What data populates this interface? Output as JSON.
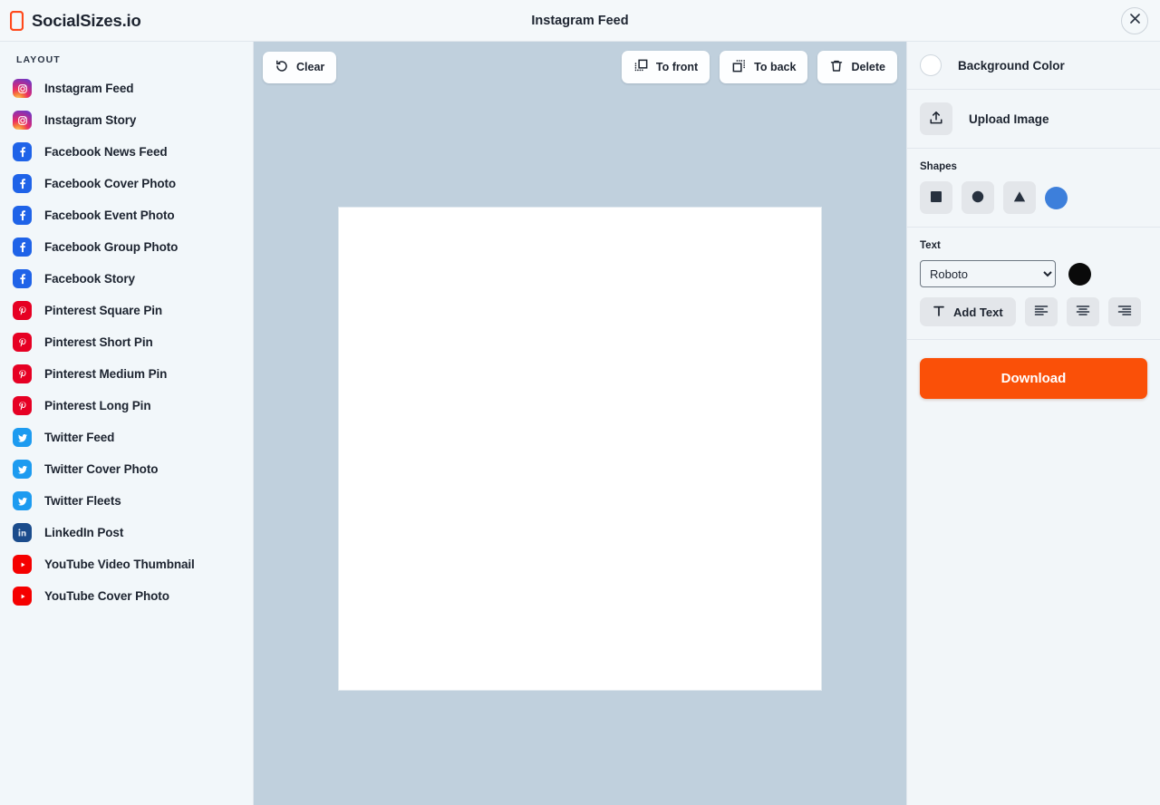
{
  "header": {
    "brand": "SocialSizes.io",
    "brand_icon": "phone-frame-icon",
    "title": "Instagram Feed",
    "close_icon": "close-icon"
  },
  "sidebar": {
    "heading": "LAYOUT",
    "items": [
      {
        "label": "Instagram Feed",
        "icon": "instagram-icon",
        "brand": "instagram"
      },
      {
        "label": "Instagram Story",
        "icon": "instagram-icon",
        "brand": "instagram"
      },
      {
        "label": "Facebook News Feed",
        "icon": "facebook-icon",
        "brand": "facebook"
      },
      {
        "label": "Facebook Cover Photo",
        "icon": "facebook-icon",
        "brand": "facebook"
      },
      {
        "label": "Facebook Event Photo",
        "icon": "facebook-icon",
        "brand": "facebook"
      },
      {
        "label": "Facebook Group Photo",
        "icon": "facebook-icon",
        "brand": "facebook"
      },
      {
        "label": "Facebook Story",
        "icon": "facebook-icon",
        "brand": "facebook"
      },
      {
        "label": "Pinterest Square Pin",
        "icon": "pinterest-icon",
        "brand": "pinterest"
      },
      {
        "label": "Pinterest Short Pin",
        "icon": "pinterest-icon",
        "brand": "pinterest"
      },
      {
        "label": "Pinterest Medium Pin",
        "icon": "pinterest-icon",
        "brand": "pinterest"
      },
      {
        "label": "Pinterest Long Pin",
        "icon": "pinterest-icon",
        "brand": "pinterest"
      },
      {
        "label": "Twitter Feed",
        "icon": "twitter-icon",
        "brand": "twitter"
      },
      {
        "label": "Twitter Cover Photo",
        "icon": "twitter-icon",
        "brand": "twitter"
      },
      {
        "label": "Twitter Fleets",
        "icon": "twitter-icon",
        "brand": "twitter"
      },
      {
        "label": "LinkedIn Post",
        "icon": "linkedin-icon",
        "brand": "linkedin"
      },
      {
        "label": "YouTube Video Thumbnail",
        "icon": "youtube-icon",
        "brand": "youtube"
      },
      {
        "label": "YouTube Cover Photo",
        "icon": "youtube-icon",
        "brand": "youtube"
      }
    ]
  },
  "toolbar": {
    "clear_label": "Clear",
    "clear_icon": "rotate-ccw-icon",
    "to_front_label": "To front",
    "to_front_icon": "bring-to-front-icon",
    "to_back_label": "To back",
    "to_back_icon": "send-to-back-icon",
    "delete_label": "Delete",
    "delete_icon": "trash-icon"
  },
  "canvas": {
    "background_color": "#ffffff",
    "area_color": "#c0d0dd"
  },
  "right_panel": {
    "background_color_label": "Background Color",
    "background_color_value": "#ffffff",
    "upload_image_label": "Upload Image",
    "upload_icon": "upload-icon",
    "shapes_label": "Shapes",
    "shapes": [
      {
        "name": "square-shape",
        "icon": "square-icon"
      },
      {
        "name": "circle-shape",
        "icon": "circle-icon"
      },
      {
        "name": "triangle-shape",
        "icon": "triangle-icon"
      }
    ],
    "shape_color_value": "#3d7fdb",
    "text_label": "Text",
    "font_selected": "Roboto",
    "font_options": [
      "Roboto"
    ],
    "text_color_value": "#0a0a0a",
    "add_text_label": "Add Text",
    "add_text_icon": "text-t-icon",
    "align_buttons": [
      {
        "name": "align-left-button",
        "icon": "align-left-icon"
      },
      {
        "name": "align-center-button",
        "icon": "align-center-icon"
      },
      {
        "name": "align-right-button",
        "icon": "align-right-icon"
      }
    ],
    "download_label": "Download",
    "download_color": "#fa5008"
  }
}
